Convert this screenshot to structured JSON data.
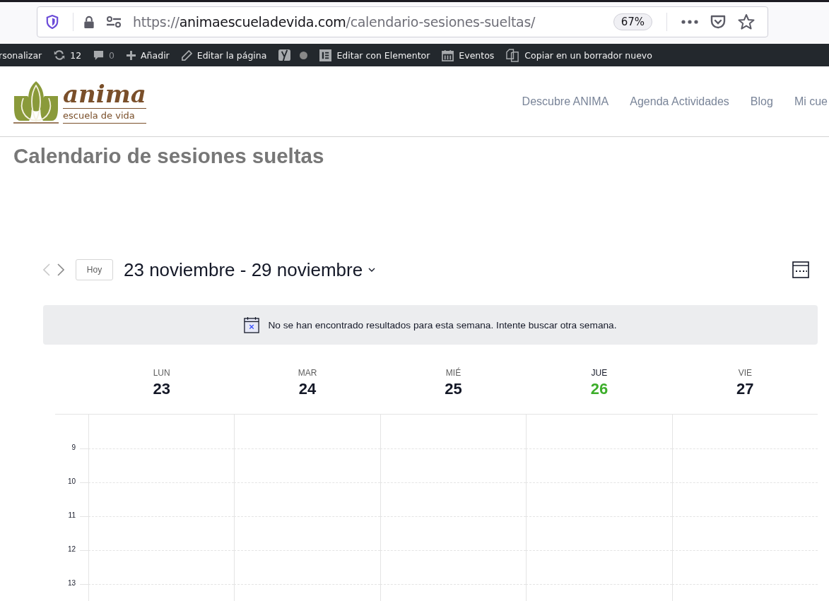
{
  "browser": {
    "url": {
      "scheme": "https://",
      "host": "animaescueladevida.com",
      "path": "/calendario-sesiones-sueltas/"
    },
    "zoom": "67%"
  },
  "admin_bar": [
    {
      "kind": "text",
      "label": "rsonalizar"
    },
    {
      "kind": "updates",
      "label": "12"
    },
    {
      "kind": "comments",
      "label": "0"
    },
    {
      "kind": "add",
      "label": "Añadir"
    },
    {
      "kind": "edit",
      "label": "Editar la página"
    },
    {
      "kind": "seo"
    },
    {
      "kind": "elementor",
      "label": "Editar con Elementor"
    },
    {
      "kind": "events",
      "label": "Eventos"
    },
    {
      "kind": "copy",
      "label": "Copiar en un borrador nuevo"
    }
  ],
  "logo": {
    "name": "anima",
    "tagline": "escuela de vida"
  },
  "nav": [
    "Descubre ANIMA",
    "Agenda Actividades",
    "Blog",
    "Mi cue"
  ],
  "page_title": "Calendario de sesiones sueltas",
  "calendar": {
    "today_button": "Hoy",
    "range": "23 noviembre - 29 noviembre",
    "notice": "No se han encontrado resultados para esta semana. Intente buscar otra semana.",
    "days": [
      {
        "name": "LUN",
        "date": "23",
        "today": false
      },
      {
        "name": "MAR",
        "date": "24",
        "today": false
      },
      {
        "name": "MIÉ",
        "date": "25",
        "today": false
      },
      {
        "name": "JUE",
        "date": "26",
        "today": true
      },
      {
        "name": "VIE",
        "date": "27",
        "today": false
      }
    ],
    "hours": [
      "9",
      "10",
      "11",
      "12",
      "13"
    ]
  }
}
